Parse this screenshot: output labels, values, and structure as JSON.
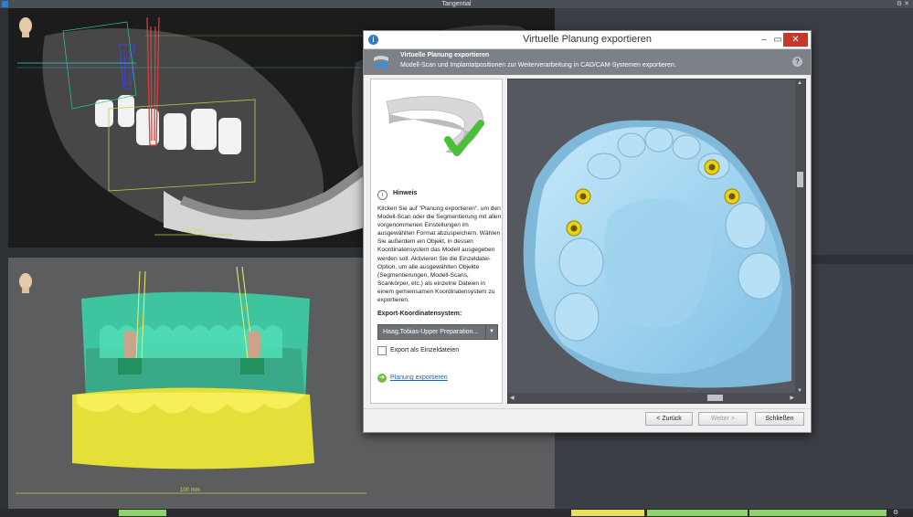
{
  "app": {
    "window_title": "Tangential"
  },
  "ct_view": {
    "ruler_label": "100 mm"
  },
  "model_view": {
    "ruler_label": "100 mm"
  },
  "dialog": {
    "title": "Virtuelle Planung exportieren",
    "header": {
      "title": "Virtuelle Planung exportieren",
      "subtitle": "Modell-Scan und Implantatpositionen zur Weiterverarbeitung in CAD/CAM-Systemen exportieren."
    },
    "hint": {
      "label": "Hinweis",
      "text": "Klicken Sie auf \"Planung exportieren\", um den Modell-Scan oder die Segmentierung mit allen vorgenommenen Einstellungen im ausgewählten Format abzuspeichern. Wählen Sie außerdem ein Objekt, in dessen Koordinatensystem das Modell ausgegeben werden soll. Aktivieren Sie die Einzeldatei-Option, um alle ausgewählten Objekte (Segmentierungen, Modell-Scans, Scankörper, etc.) als einzelne Dateien in einem gemeinsamen Koordinatensystem zu exportieren."
    },
    "coordinate_system": {
      "label": "Export-Koordinatensystem:",
      "selected": "Haag,Tobias-Upper Preparation..."
    },
    "export_single_files": {
      "label": "Export als Einzeldateien",
      "checked": false
    },
    "export_link": "Planung exportieren",
    "buttons": {
      "back": "< Zurück",
      "next": "Weiter >",
      "close": "Schließen"
    }
  },
  "colors": {
    "accent_close": "#c9372c",
    "header_bg": "#7c8087",
    "model_blue": "#a8d8f0",
    "implant_yellow": "#e8d21a",
    "link_blue": "#1d63b5"
  }
}
